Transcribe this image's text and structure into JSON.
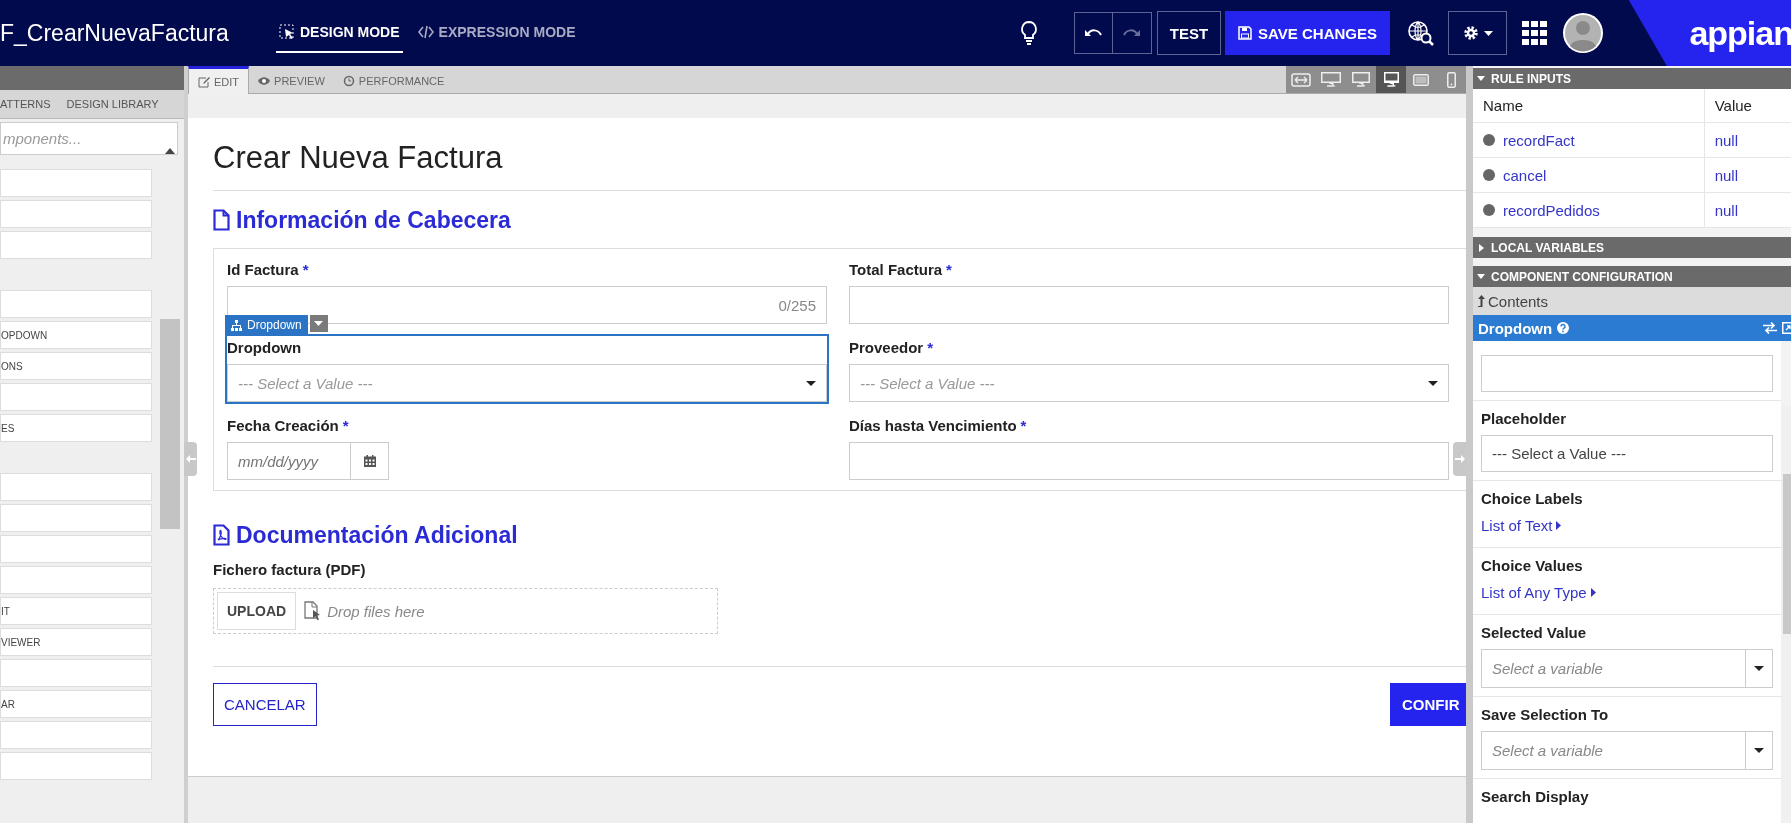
{
  "app": {
    "title": "F_CrearNuevaFactura",
    "modes": [
      {
        "kind": "design",
        "label": "DESIGN MODE",
        "selected": true
      },
      {
        "kind": "expression",
        "label": "EXPRESSION MODE",
        "selected": false
      }
    ],
    "undo": {
      "disabled": false
    },
    "redo": {
      "disabled": true
    },
    "test": "TEST",
    "save": "SAVE CHANGES",
    "logo": "appian"
  },
  "palette": {
    "tabs": [
      "ATTERNS",
      "DESIGN LIBRARY"
    ],
    "search": {
      "placeholder": "mponents..."
    },
    "groups": [
      {
        "items": [
          {
            "kind": "blank"
          },
          {
            "kind": "blank"
          },
          {
            "kind": "blank"
          }
        ]
      },
      {
        "items": [
          {
            "kind": "blank"
          },
          {
            "kind": "labeled",
            "label": "OPDOWN"
          },
          {
            "kind": "labeled",
            "label": "ONS"
          },
          {
            "kind": "blank"
          },
          {
            "kind": "labeled",
            "label": "ES"
          }
        ]
      },
      {
        "items": [
          {
            "kind": "blank"
          },
          {
            "kind": "blank"
          },
          {
            "kind": "blank"
          },
          {
            "kind": "blank"
          },
          {
            "kind": "labeled",
            "label": "IT"
          },
          {
            "kind": "labeled",
            "label": "VIEWER"
          },
          {
            "kind": "blank"
          },
          {
            "kind": "labeled",
            "label": "AR"
          },
          {
            "kind": "blank"
          },
          {
            "kind": "blank"
          }
        ]
      }
    ]
  },
  "editor": {
    "tabs": [
      {
        "kind": "edit",
        "label": "EDIT",
        "selected": true
      },
      {
        "kind": "preview",
        "label": "PREVIEW",
        "selected": false
      },
      {
        "kind": "performance",
        "label": "PERFORMANCE",
        "selected": false
      }
    ],
    "devices": [
      {
        "kind": "fit",
        "selected": false
      },
      {
        "kind": "wide",
        "selected": false
      },
      {
        "kind": "monitor",
        "selected": false
      },
      {
        "kind": "desktop",
        "selected": true
      },
      {
        "kind": "tablet",
        "selected": false
      },
      {
        "kind": "phone",
        "selected": false
      }
    ]
  },
  "form": {
    "title": "Crear Nueva Factura",
    "header_section": {
      "title": "Información de Cabecera",
      "fields": [
        {
          "kind": "text",
          "label": "Id Factura",
          "mark": "*",
          "counter": "0/255",
          "selected": false
        },
        {
          "kind": "text",
          "label": "Total Factura",
          "mark": "*",
          "selected": false
        },
        {
          "kind": "dropdown",
          "label": "Dropdown",
          "placeholder": "--- Select a Value ---",
          "selected": true,
          "tag": "Dropdown"
        },
        {
          "kind": "dropdown",
          "label": "Proveedor",
          "mark": "*",
          "placeholder": "--- Select a Value ---",
          "selected": false
        },
        {
          "kind": "date",
          "label": "Fecha Creación",
          "mark": "*",
          "placeholder": "mm/dd/yyyy",
          "selected": false
        },
        {
          "kind": "text",
          "label": "Días hasta Vencimiento",
          "mark": "*",
          "selected": false
        }
      ]
    },
    "docs_section": {
      "title": "Documentación Adicional",
      "upload": {
        "label": "Fichero factura (PDF)",
        "button": "UPLOAD",
        "hint": "Drop files here"
      }
    },
    "buttons": {
      "cancel": "CANCELAR",
      "confirm": "CONFIR"
    }
  },
  "rule_inputs": {
    "title": "RULE INPUTS",
    "expanded": true,
    "columns": [
      "Name",
      "Value"
    ],
    "rows": [
      {
        "name": "recordFact",
        "value": "null"
      },
      {
        "name": "cancel",
        "value": "null"
      },
      {
        "name": "recordPedidos",
        "value": "null"
      }
    ]
  },
  "local_variables": {
    "title": "LOCAL VARIABLES",
    "expanded": false
  },
  "component_configuration": {
    "title": "COMPONENT CONFIGURATION",
    "expanded": true,
    "breadcrumb": "Contents",
    "component": "Dropdown",
    "properties": [
      {
        "kind": "field"
      },
      {
        "kind": "field",
        "label": "Placeholder",
        "value": "--- Select a Value ---"
      },
      {
        "kind": "link",
        "label": "Choice Labels",
        "value": "List of Text"
      },
      {
        "kind": "link",
        "label": "Choice Values",
        "value": "List of Any Type"
      },
      {
        "kind": "select",
        "label": "Selected Value",
        "placeholder": "Select a variable"
      },
      {
        "kind": "select",
        "label": "Save Selection To",
        "placeholder": "Select a variable"
      },
      {
        "kind": "heading",
        "label": "Search Display"
      }
    ]
  }
}
